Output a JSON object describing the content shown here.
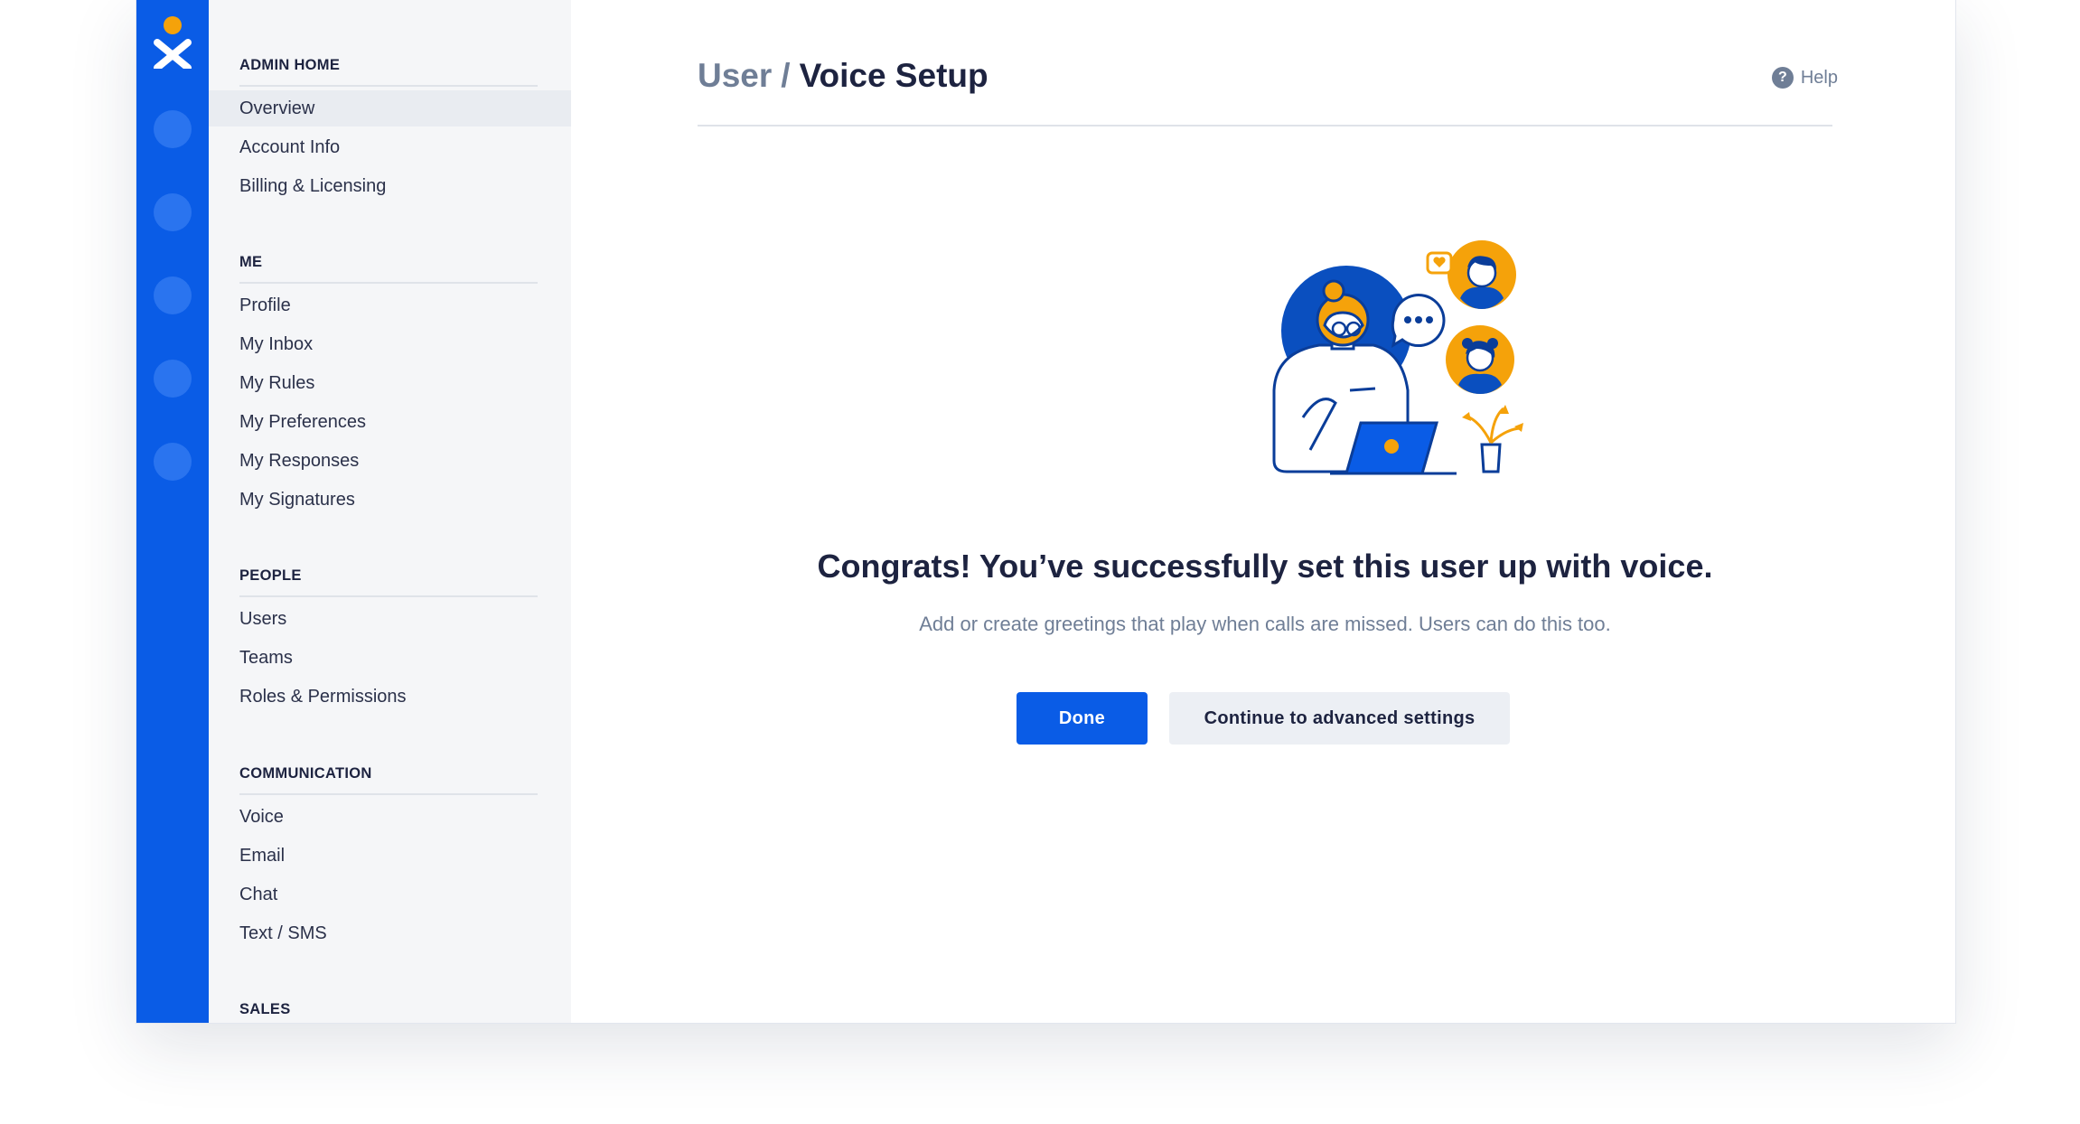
{
  "sidebar": {
    "sections": [
      {
        "title": "ADMIN HOME",
        "items": [
          "Overview",
          "Account Info",
          "Billing & Licensing"
        ]
      },
      {
        "title": "ME",
        "items": [
          "Profile",
          "My Inbox",
          "My Rules",
          "My Preferences",
          "My Responses",
          "My Signatures"
        ]
      },
      {
        "title": "PEOPLE",
        "items": [
          "Users",
          "Teams",
          "Roles & Permissions"
        ]
      },
      {
        "title": "COMMUNICATION",
        "items": [
          "Voice",
          "Email",
          "Chat",
          "Text / SMS"
        ]
      },
      {
        "title": "SALES",
        "items": []
      }
    ],
    "active_item": "Overview"
  },
  "header": {
    "parent": "User",
    "separator": "/",
    "current": "Voice Setup",
    "help_label": "Help"
  },
  "content": {
    "headline": "Congrats! You’ve successfully set this user up with voice.",
    "subtext": "Add or create greetings that play when calls are missed. Users can do this too.",
    "primary_button": "Done",
    "secondary_button": "Continue to advanced settings"
  },
  "icons": {
    "logo": "nextiva-logo-icon",
    "rail": [
      "nav-rail-icon-1",
      "nav-rail-icon-2",
      "nav-rail-icon-3",
      "nav-rail-icon-4",
      "nav-rail-icon-5"
    ],
    "help": "question-circle-icon"
  },
  "colors": {
    "brand_blue": "#0a5ce6",
    "accent_orange": "#f5a20a",
    "navy_text": "#1d2340",
    "muted_text": "#6f7e96"
  }
}
